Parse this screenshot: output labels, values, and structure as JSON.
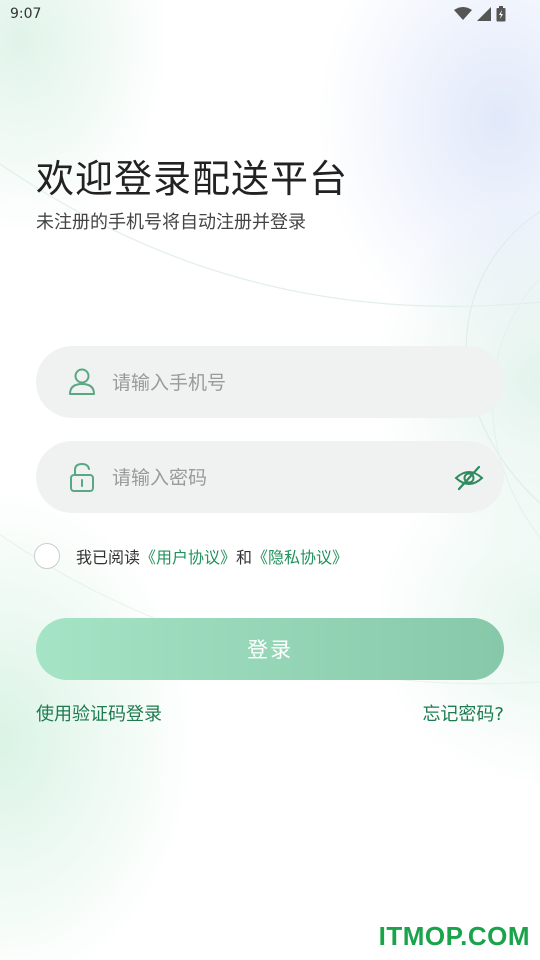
{
  "status_bar": {
    "time": "9:07"
  },
  "header": {
    "title": "欢迎登录配送平台",
    "subtitle": "未注册的手机号将自动注册并登录"
  },
  "form": {
    "phone_placeholder": "请输入手机号",
    "password_placeholder": "请输入密码"
  },
  "agreement": {
    "prefix": "我已阅读",
    "user_agreement": "《用户协议》",
    "conjunction": "和",
    "privacy_policy": "《隐私协议》",
    "checked": false
  },
  "actions": {
    "login_label": "登录",
    "sms_login": "使用验证码登录",
    "forgot_password": "忘记密码?"
  },
  "watermark": "ITMOP.COM",
  "colors": {
    "accent": "#21915c",
    "button_start": "#a5e4c5",
    "button_end": "#86c8a9",
    "field_bg": "#f0f2f1"
  }
}
